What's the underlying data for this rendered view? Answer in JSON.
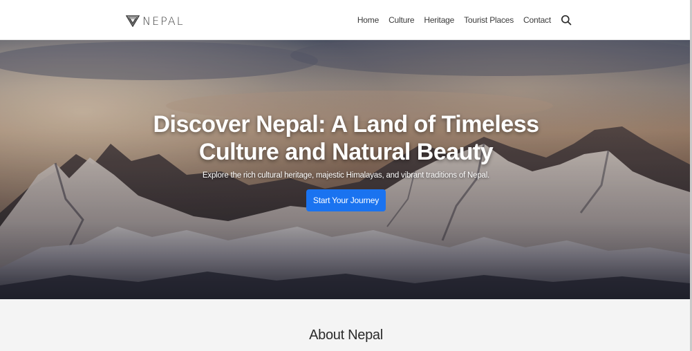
{
  "brand": {
    "logo_icon": "mountain-shield-icon",
    "name": "NEPAL"
  },
  "nav": {
    "links": [
      {
        "label": "Home"
      },
      {
        "label": "Culture"
      },
      {
        "label": "Heritage"
      },
      {
        "label": "Tourist Places"
      },
      {
        "label": "Contact"
      }
    ],
    "search_icon": "search-icon"
  },
  "hero": {
    "title_line1": "Discover Nepal: A Land of Timeless",
    "title_line2": "Culture and Natural Beauty",
    "subtitle": "Explore the rich cultural heritage, majestic Himalayas, and vibrant traditions of Nepal.",
    "button_label": "Start Your Journey",
    "background": "snow-capped-himalaya-mountains-photo"
  },
  "about": {
    "title": "About Nepal"
  },
  "colors": {
    "accent": "#1a73f0",
    "navbar_bg": "#ffffff",
    "section_bg": "#f4f4f4"
  }
}
